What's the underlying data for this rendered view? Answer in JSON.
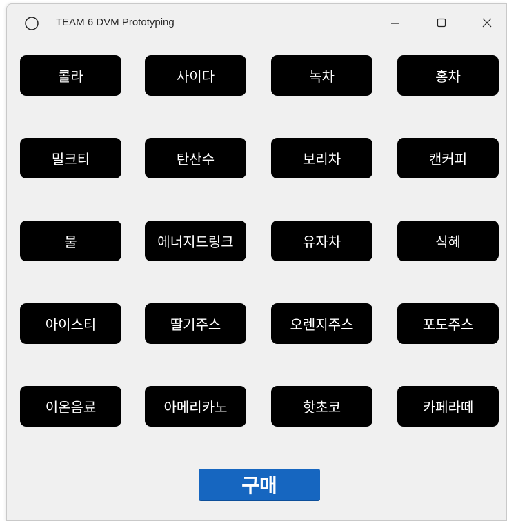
{
  "window": {
    "title": "TEAM 6 DVM Prototyping",
    "app_icon": "circle-icon",
    "controls": {
      "minimize": "minimize-icon",
      "maximize": "maximize-icon",
      "close": "close-icon"
    }
  },
  "drinks": [
    "콜라",
    "사이다",
    "녹차",
    "홍차",
    "밀크티",
    "탄산수",
    "보리차",
    "캔커피",
    "물",
    "에너지드링크",
    "유자차",
    "식혜",
    "아이스티",
    "딸기주스",
    "오렌지주스",
    "포도주스",
    "이온음료",
    "아메리카노",
    "핫초코",
    "카페라떼"
  ],
  "purchase": {
    "label": "구매",
    "color": "#1666c0"
  },
  "colors": {
    "window_bg": "#f0f0f0",
    "drink_button_bg": "#000000",
    "drink_button_text": "#ffffff"
  }
}
